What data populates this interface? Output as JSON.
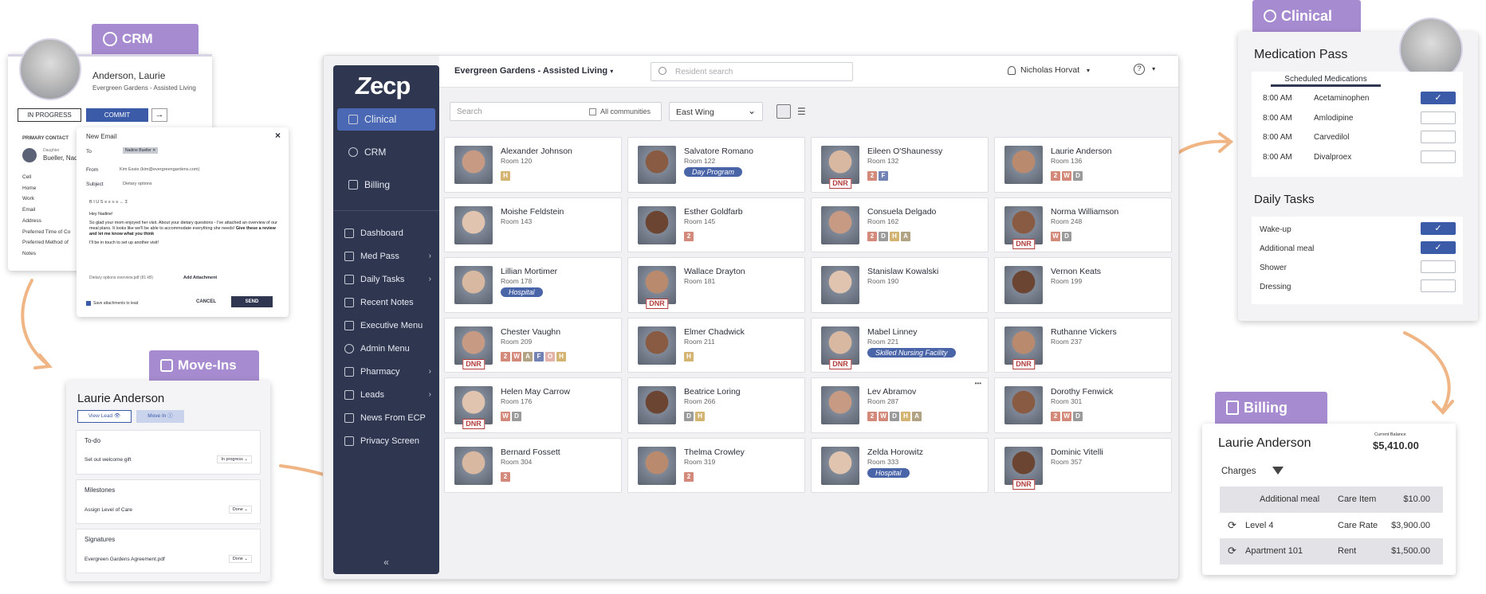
{
  "crm_card": {
    "tag": "CRM",
    "name": "Anderson, Laurie",
    "community": "Evergreen Gardens - Assisted Living",
    "btn_progress": "IN PROGRESS",
    "btn_commit": "COMMIT",
    "primary_contact_label": "PRIMARY CONTACT",
    "contact_relation": "Daughter",
    "contact_name": "Bueller, Nad",
    "fields": [
      "Cell",
      "Home",
      "Work",
      "Email",
      "Address",
      "Preferred Time of Co",
      "Preferred Method of",
      "Notes"
    ]
  },
  "email_card": {
    "title": "New Email",
    "to_label": "To",
    "to_value": "Nadine Bueller",
    "from_label": "From",
    "from_value": "Kim Essie (kim@evergreengardens.com)",
    "subject_label": "Subject",
    "subject_value": "Dietary options",
    "toolbar": "B  I  U  S   ≡  ≡  ≡  ≡   ←  Σ",
    "greeting": "Hey Nadine!",
    "body": "So glad your mom enjoyed her visit. About your dietary questions - I've attached an overview of our meal plans. It looks like we'll be able to accommodate everything she needs!",
    "body_bold": "Give these a review and let me know what you think",
    "closing": "I'll be in touch to set up another visit!",
    "attachment": "Dietary options overview.pdf (81 kB)",
    "add_attachment": "Add Attachment",
    "save_label": "Save attachments to lead",
    "cancel": "CANCEL",
    "send": "SEND"
  },
  "movein_card": {
    "tag": "Move-Ins",
    "name": "Laurie Anderson",
    "btn_view_lead": "View Lead",
    "btn_move_in": "Move In",
    "todo_title": "To-do",
    "todo_item": "Set out welcome gift",
    "todo_status": "In progress",
    "milestones_title": "Milestones",
    "milestone_item": "Assign Level of Care",
    "milestone_status": "Done",
    "signatures_title": "Signatures",
    "signature_item": "Evergreen Gardens Agreement.pdf",
    "signature_status": "Done"
  },
  "app": {
    "logo": "ecp",
    "community": "Evergreen Gardens - Assisted Living",
    "resident_search_placeholder": "Resident search",
    "user": "Nicholas Horvat",
    "search_placeholder": "Search",
    "all_communities": "All communities",
    "wing": "East Wing",
    "top_nav": [
      {
        "label": "Clinical",
        "active": true
      },
      {
        "label": "CRM",
        "active": false
      },
      {
        "label": "Billing",
        "active": false
      }
    ],
    "menu": [
      {
        "label": "Dashboard",
        "chev": false
      },
      {
        "label": "Med Pass",
        "chev": true
      },
      {
        "label": "Daily Tasks",
        "chev": true
      },
      {
        "label": "Recent Notes",
        "chev": false
      },
      {
        "label": "Executive Menu",
        "chev": false
      },
      {
        "label": "Admin Menu",
        "chev": false
      },
      {
        "label": "Pharmacy",
        "chev": true
      },
      {
        "label": "Leads",
        "chev": true
      },
      {
        "label": "News From ECP",
        "chev": false
      },
      {
        "label": "Privacy Screen",
        "chev": false
      }
    ],
    "collapse": "«",
    "residents": [
      {
        "name": "Alexander Johnson",
        "room": "Room 120",
        "badges": [
          "H"
        ],
        "pill": "",
        "dnr": false
      },
      {
        "name": "Salvatore Romano",
        "room": "Room 122",
        "badges": [],
        "pill": "Day Program",
        "dnr": false
      },
      {
        "name": "Eileen O'Shaunessy",
        "room": "Room 132",
        "badges": [
          "2",
          "F"
        ],
        "pill": "",
        "dnr": true
      },
      {
        "name": "Laurie Anderson",
        "room": "Room 136",
        "badges": [
          "2",
          "W",
          "D"
        ],
        "pill": "",
        "dnr": false
      },
      {
        "name": "Moishe Feldstein",
        "room": "Room 143",
        "badges": [],
        "pill": "",
        "dnr": false
      },
      {
        "name": "Esther Goldfarb",
        "room": "Room 145",
        "badges": [
          "2"
        ],
        "pill": "",
        "dnr": false
      },
      {
        "name": "Consuela Delgado",
        "room": "Room 162",
        "badges": [
          "2",
          "D",
          "H",
          "A"
        ],
        "pill": "",
        "dnr": false
      },
      {
        "name": "Norma Williamson",
        "room": "Room 248",
        "badges": [
          "W",
          "D"
        ],
        "pill": "",
        "dnr": true
      },
      {
        "name": "Lillian Mortimer",
        "room": "Room 178",
        "badges": [],
        "pill": "Hospital",
        "dnr": false
      },
      {
        "name": "Wallace Drayton",
        "room": "Room 181",
        "badges": [],
        "pill": "",
        "dnr": true
      },
      {
        "name": "Stanislaw Kowalski",
        "room": "Room 190",
        "badges": [],
        "pill": "",
        "dnr": false
      },
      {
        "name": "Vernon Keats",
        "room": "Room 199",
        "badges": [],
        "pill": "",
        "dnr": false
      },
      {
        "name": "Chester Vaughn",
        "room": "Room 209",
        "badges": [
          "2",
          "W",
          "A",
          "F",
          "O",
          "H"
        ],
        "pill": "",
        "dnr": true
      },
      {
        "name": "Elmer Chadwick",
        "room": "Room 211",
        "badges": [
          "H"
        ],
        "pill": "",
        "dnr": false
      },
      {
        "name": "Mabel Linney",
        "room": "Room 221",
        "badges": [],
        "pill": "Skilled Nursing Facility",
        "dnr": true
      },
      {
        "name": "Ruthanne Vickers",
        "room": "Room 237",
        "badges": [],
        "pill": "",
        "dnr": true
      },
      {
        "name": "Helen May Carrow",
        "room": "Room 176",
        "badges": [
          "W",
          "D"
        ],
        "pill": "",
        "dnr": true
      },
      {
        "name": "Beatrice Loring",
        "room": "Room 266",
        "badges": [
          "D",
          "H"
        ],
        "pill": "",
        "dnr": false
      },
      {
        "name": "Lev Abramov",
        "room": "Room 287",
        "badges": [
          "2",
          "W",
          "D",
          "H",
          "A"
        ],
        "pill": "",
        "dnr": false
      },
      {
        "name": "Dorothy Fenwick",
        "room": "Room 301",
        "badges": [
          "2",
          "W",
          "D"
        ],
        "pill": "",
        "dnr": false
      },
      {
        "name": "Bernard Fossett",
        "room": "Room 304",
        "badges": [
          "2"
        ],
        "pill": "",
        "dnr": false
      },
      {
        "name": "Thelma Crowley",
        "room": "Room 319",
        "badges": [
          "2"
        ],
        "pill": "",
        "dnr": false
      },
      {
        "name": "Zelda Horowitz",
        "room": "Room 333",
        "badges": [],
        "pill": "Hospital",
        "dnr": false
      },
      {
        "name": "Dominic Vitelli",
        "room": "Room 357",
        "badges": [],
        "pill": "",
        "dnr": true
      }
    ]
  },
  "clinical_card": {
    "tag": "Clinical",
    "med_title": "Medication Pass",
    "sched_title": "Scheduled Medications",
    "meds": [
      {
        "time": "8:00 AM",
        "name": "Acetaminophen",
        "checked": true
      },
      {
        "time": "8:00 AM",
        "name": "Amlodipine",
        "checked": false
      },
      {
        "time": "8:00 AM",
        "name": "Carvedilol",
        "checked": false
      },
      {
        "time": "8:00 AM",
        "name": "Divalproex",
        "checked": false
      }
    ],
    "tasks_title": "Daily Tasks",
    "tasks": [
      {
        "name": "Wake-up",
        "checked": true
      },
      {
        "name": "Additional meal",
        "checked": true
      },
      {
        "name": "Shower",
        "checked": false
      },
      {
        "name": "Dressing",
        "checked": false
      }
    ]
  },
  "billing_card": {
    "tag": "Billing",
    "name": "Laurie Anderson",
    "balance_label": "Current Balance",
    "balance": "$5,410.00",
    "charges_label": "Charges",
    "rows": [
      {
        "item": "Additional meal",
        "type": "Care Item",
        "amount": "$10.00"
      },
      {
        "item": "Level 4",
        "type": "Care Rate",
        "amount": "$3,900.00"
      },
      {
        "item": "Apartment 101",
        "type": "Rent",
        "amount": "$1,500.00"
      }
    ]
  },
  "colors": {
    "purple": "#a78bd0",
    "navy": "#2f3650",
    "accent": "#3b5ba9",
    "arrow": "#f0b585"
  }
}
